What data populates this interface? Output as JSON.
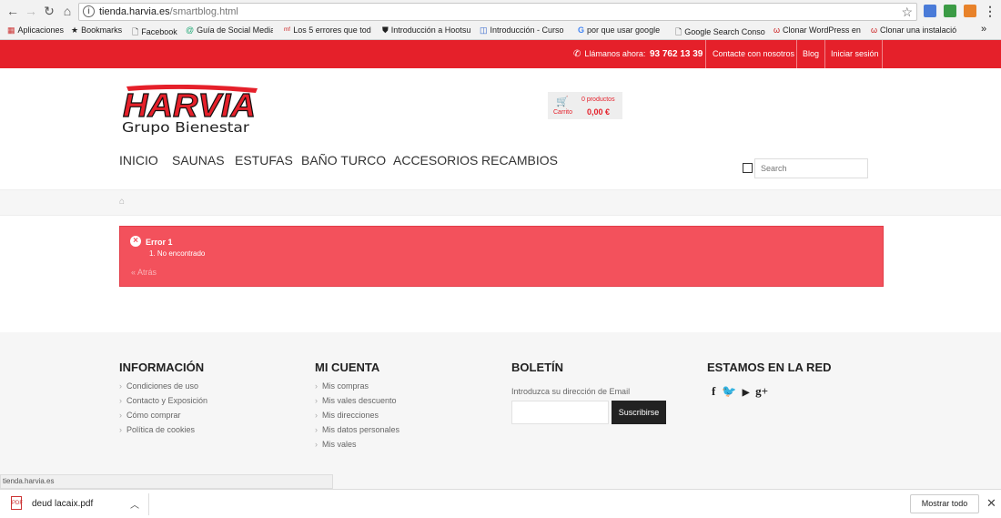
{
  "browser": {
    "url_host": "tienda.harvia.es",
    "url_path": "/smartblog.html",
    "bookmarks": [
      {
        "icon": "apps-icon",
        "glyph": "▦",
        "label": "Aplicaciones"
      },
      {
        "icon": "star-icon",
        "glyph": "★",
        "label": "Bookmarks"
      },
      {
        "icon": "page-icon",
        "glyph": "🗋",
        "label": "Facebook"
      },
      {
        "icon": "at-icon",
        "glyph": "@",
        "label": "Guía de Social Media"
      },
      {
        "icon": "mf-icon",
        "glyph": "ᵐᶠ",
        "label": "Los 5 errores que tod"
      },
      {
        "icon": "shield-icon",
        "glyph": "⛊",
        "label": "Introducción a Hootsu"
      },
      {
        "icon": "tab-icon",
        "glyph": "◫",
        "label": "Introducción - Curso"
      },
      {
        "icon": "google-icon",
        "glyph": "G",
        "label": "por que usar google"
      },
      {
        "icon": "page-icon",
        "glyph": "🗋",
        "label": "Google Search Conso"
      },
      {
        "icon": "w-icon",
        "glyph": "ω",
        "label": "Clonar WordPress en"
      },
      {
        "icon": "w-icon",
        "glyph": "ω",
        "label": "Clonar una instalació"
      }
    ],
    "overflow_glyph": "»"
  },
  "topbar": {
    "call_label": "Llámanos ahora:",
    "phone": "93 762 13 39",
    "contact": "Contacte con nosotros",
    "blog": "Blog",
    "login": "Iniciar sesión"
  },
  "logo": {
    "brand": "HARVIA",
    "tagline": "Grupo Bienestar"
  },
  "cart": {
    "count_label": "0 productos",
    "label": "Carrito",
    "total": "0,00 €"
  },
  "menu": [
    "Inicio",
    "Saunas",
    "Estufas",
    "Baño turco",
    "Accesorios",
    "Recambios"
  ],
  "search": {
    "placeholder": "Search"
  },
  "error": {
    "title": "Error 1",
    "item": "1. No encontrado",
    "back": "« Atrás"
  },
  "footer": {
    "info": {
      "title": "Información",
      "links": [
        "Condiciones de uso",
        "Contacto y Exposición",
        "Cómo comprar",
        "Política de cookies"
      ]
    },
    "account": {
      "title": "Mi cuenta",
      "links": [
        "Mis compras",
        "Mis vales descuento",
        "Mis direcciones",
        "Mis datos personales",
        "Mis vales"
      ]
    },
    "newsletter": {
      "title": "Boletín",
      "prompt": "Introduzca su dirección de Email",
      "button": "Suscribirse"
    },
    "social": {
      "title": "Estamos en la red"
    }
  },
  "status_text": "tienda.harvia.es",
  "download": {
    "file": "deud lacaix.pdf",
    "show_all": "Mostrar todo"
  },
  "colors": {
    "brand_red": "#e5202a",
    "error_bg": "#f3515c"
  }
}
